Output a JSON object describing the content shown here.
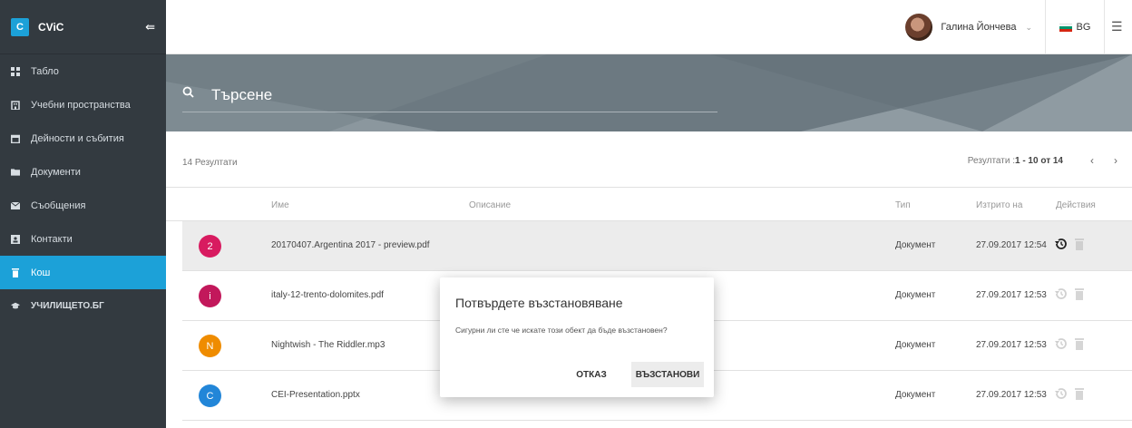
{
  "sidebar": {
    "brand_letter": "C",
    "brand_name": "CViC",
    "collapse_icon": "collapse-left-icon",
    "items": [
      {
        "label": "Табло",
        "icon": "dashboard-icon"
      },
      {
        "label": "Учебни пространства",
        "icon": "building-icon"
      },
      {
        "label": "Дейности и събития",
        "icon": "calendar-icon"
      },
      {
        "label": "Документи",
        "icon": "folder-icon"
      },
      {
        "label": "Съобщения",
        "icon": "envelope-icon"
      },
      {
        "label": "Контакти",
        "icon": "contact-icon"
      },
      {
        "label": "Кош",
        "icon": "trash-icon",
        "active": true
      },
      {
        "label": "училището.бг",
        "icon": "graduation-cap-icon"
      }
    ]
  },
  "topbar": {
    "user_name": "Галина Йончева",
    "language": "BG",
    "flag_colors": [
      "#ffffff",
      "#00966e",
      "#d62612"
    ]
  },
  "search": {
    "placeholder": "Търсене"
  },
  "results": {
    "count_text": "14 Резултати",
    "pager_prefix": "Резултати :",
    "pager_range": "1 - 10 от 14",
    "prev": "‹",
    "next": "›"
  },
  "table": {
    "headers": {
      "name": "Име",
      "description": "Описание",
      "type": "Тип",
      "deleted_on": "Изтрито на",
      "actions": "Действия"
    },
    "rows": [
      {
        "letter": "2",
        "color": "#d81b60",
        "name": "20170407.Argentina 2017 - preview.pdf",
        "type": "Документ",
        "deleted": "27.09.2017 12:54"
      },
      {
        "letter": "i",
        "color": "#c2185b",
        "name": "italy-12-trento-dolomites.pdf",
        "type": "Документ",
        "deleted": "27.09.2017 12:53"
      },
      {
        "letter": "N",
        "color": "#ef8c00",
        "name": "Nightwish - The Riddler.mp3",
        "type": "Документ",
        "deleted": "27.09.2017 12:53"
      },
      {
        "letter": "C",
        "color": "#2286d8",
        "name": "CEI-Presentation.pptx",
        "type": "Документ",
        "deleted": "27.09.2017 12:53"
      }
    ]
  },
  "dialog": {
    "title": "Потвърдете възстановяване",
    "message": "Сигурни ли сте че искате този обект да бъде възстановен?",
    "cancel": "ОТКАЗ",
    "confirm": "ВЪЗСТАНОВИ"
  }
}
